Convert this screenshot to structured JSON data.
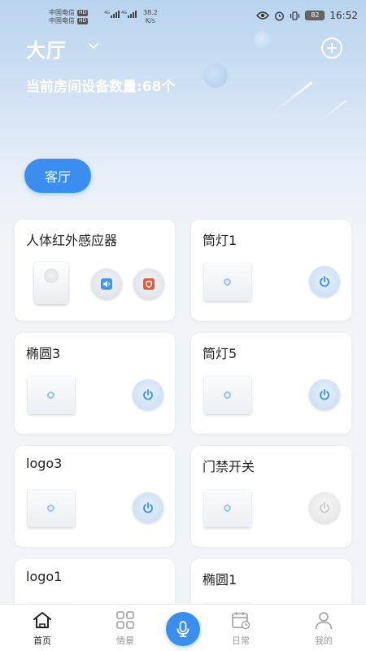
{
  "status_bar": {
    "carrier_1": "中国电信",
    "carrier_2": "中国电信",
    "tag": "HD",
    "net_1": "4G",
    "net_2": "4G",
    "speed_value": "38.2",
    "speed_unit": "K/s",
    "battery": "82",
    "time": "16:52"
  },
  "header": {
    "room_title": "大厅",
    "device_count": "当前房间设备数量:68个"
  },
  "room_chip": {
    "label": "客厅"
  },
  "devices": [
    {
      "name": "人体红外感应器",
      "type": "sensor"
    },
    {
      "name": "筒灯1",
      "type": "switch",
      "state": "on"
    },
    {
      "name": "椭圆3",
      "type": "switch",
      "state": "on"
    },
    {
      "name": "筒灯5",
      "type": "switch",
      "state": "on"
    },
    {
      "name": "logo3",
      "type": "switch",
      "state": "on"
    },
    {
      "name": "门禁开关",
      "type": "switch",
      "state": "off"
    },
    {
      "name": "logo1",
      "type": "switch",
      "state": "on"
    },
    {
      "name": "椭圆1",
      "type": "switch",
      "state": "on"
    }
  ],
  "tabbar": {
    "tabs": [
      {
        "label": "首页",
        "icon": "home-icon",
        "active": true
      },
      {
        "label": "情景",
        "icon": "scene-grid-icon",
        "active": false
      },
      {
        "label": "日常",
        "icon": "calendar-icon",
        "active": false
      },
      {
        "label": "我的",
        "icon": "profile-icon",
        "active": false
      }
    ],
    "mic_icon": "microphone-icon"
  },
  "colors": {
    "accent": "#3a8ef0",
    "power_on": "#3a8ef0",
    "alarm": "#e8553b"
  }
}
